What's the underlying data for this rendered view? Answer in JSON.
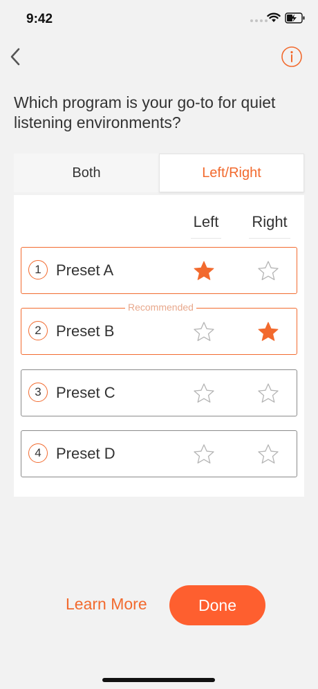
{
  "status_bar": {
    "time": "9:42"
  },
  "nav": {
    "back_icon": "chevron-left-icon",
    "info_icon": "info-circle-icon"
  },
  "question": "Which program is your go-to for quiet listening environments?",
  "tabs": [
    {
      "label": "Both",
      "selected": false
    },
    {
      "label": "Left/Right",
      "selected": true
    }
  ],
  "columns": {
    "left": "Left",
    "right": "Right"
  },
  "presets": [
    {
      "number": "1",
      "label": "Preset A",
      "left_starred": true,
      "right_starred": false,
      "badge": ""
    },
    {
      "number": "2",
      "label": "Preset B",
      "left_starred": false,
      "right_starred": true,
      "badge": "Recommended"
    },
    {
      "number": "3",
      "label": "Preset C",
      "left_starred": false,
      "right_starred": false,
      "badge": ""
    },
    {
      "number": "4",
      "label": "Preset D",
      "left_starred": false,
      "right_starred": false,
      "badge": ""
    }
  ],
  "footer": {
    "learn_more": "Learn More",
    "done": "Done"
  },
  "colors": {
    "accent": "#f26a2e",
    "done_button": "#fe5f2f",
    "background": "#f2f2f2"
  }
}
